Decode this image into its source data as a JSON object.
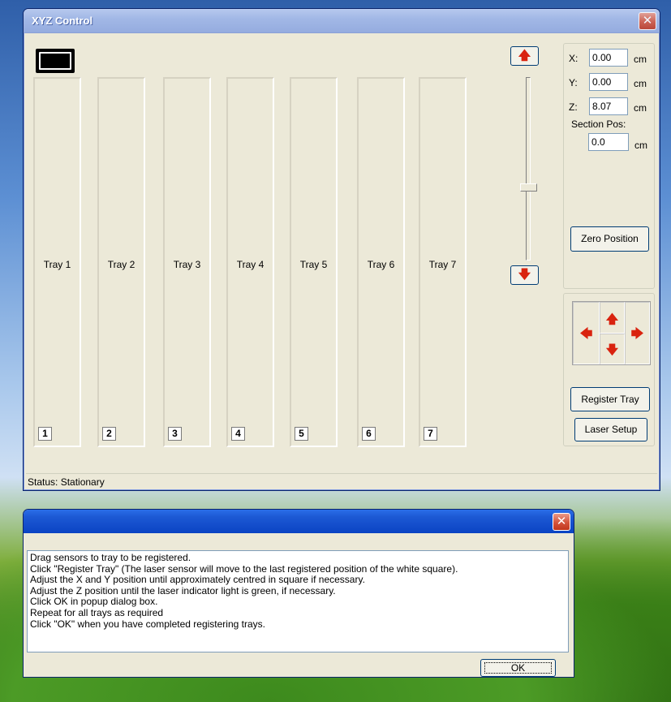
{
  "main_window": {
    "title": "XYZ Control",
    "close_glyph": "✕",
    "trays": [
      {
        "label": "Tray 1",
        "number": "1"
      },
      {
        "label": "Tray 2",
        "number": "2"
      },
      {
        "label": "Tray 3",
        "number": "3"
      },
      {
        "label": "Tray 4",
        "number": "4"
      },
      {
        "label": "Tray 5",
        "number": "5"
      },
      {
        "label": "Tray 6",
        "number": "6"
      },
      {
        "label": "Tray 7",
        "number": "7"
      }
    ],
    "position": {
      "x_label": "X:",
      "x_value": "0.00",
      "x_unit": "cm",
      "y_label": "Y:",
      "y_value": "0.00",
      "y_unit": "cm",
      "z_label": "Z:",
      "z_value": "8.07",
      "z_unit": "cm",
      "section_label": "Section Pos:",
      "section_value": "0.0",
      "section_unit": "cm"
    },
    "buttons": {
      "zero_position": "Zero Position",
      "register_tray": "Register Tray",
      "laser_setup": "Laser Setup"
    },
    "arrows": {
      "up": "🡅",
      "down": "🡇",
      "left": "🡄",
      "right": "🡆"
    },
    "status": "Status: Stationary"
  },
  "dialog": {
    "close_glyph": "✕",
    "lines": [
      "Drag sensors to tray to be registered.",
      "Click \"Register Tray\" (The laser sensor will move to the last registered position of the white square).",
      "Adjust the X and Y position until approximately centred in square if necessary.",
      "Adjust the Z position until the laser indicator light is green, if necessary.",
      "Click OK in popup dialog box.",
      "Repeat for all trays as required",
      "Click \"OK\" when you have completed registering trays."
    ],
    "ok_label": "OK"
  },
  "colors": {
    "arrow": "#d9230f",
    "title_active": "#0a43c3",
    "title_inactive": "#a2b8e6"
  }
}
